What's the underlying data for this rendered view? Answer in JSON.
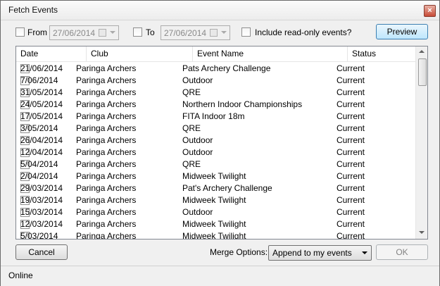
{
  "window": {
    "title": "Fetch Events",
    "close_glyph": "×"
  },
  "filters": {
    "from_label": "From",
    "from_date": "27/06/2014",
    "to_label": "To",
    "to_date": "27/06/2014",
    "readonly_label": "Include read-only events?",
    "preview_label": "Preview"
  },
  "table": {
    "columns": [
      "Date",
      "Club",
      "Event Name",
      "Status"
    ],
    "rows": [
      [
        "21/06/2014",
        "Paringa Archers",
        "Pats Archery Challenge",
        "Current"
      ],
      [
        "7/06/2014",
        "Paringa Archers",
        "Outdoor",
        "Current"
      ],
      [
        "31/05/2014",
        "Paringa Archers",
        "QRE",
        "Current"
      ],
      [
        "24/05/2014",
        "Paringa Archers",
        "Northern Indoor Championships",
        "Current"
      ],
      [
        "17/05/2014",
        "Paringa Archers",
        "FITA Indoor 18m",
        "Current"
      ],
      [
        "3/05/2014",
        "Paringa Archers",
        "QRE",
        "Current"
      ],
      [
        "26/04/2014",
        "Paringa Archers",
        "Outdoor",
        "Current"
      ],
      [
        "12/04/2014",
        "Paringa Archers",
        "Outdoor",
        "Current"
      ],
      [
        "5/04/2014",
        "Paringa Archers",
        "QRE",
        "Current"
      ],
      [
        "2/04/2014",
        "Paringa Archers",
        "Midweek Twilight",
        "Current"
      ],
      [
        "29/03/2014",
        "Paringa Archers",
        "Pat's Archery Challenge",
        "Current"
      ],
      [
        "19/03/2014",
        "Paringa Archers",
        "Midweek Twilight",
        "Current"
      ],
      [
        "15/03/2014",
        "Paringa Archers",
        "Outdoor",
        "Current"
      ],
      [
        "12/03/2014",
        "Paringa Archers",
        "Midweek Twilight",
        "Current"
      ],
      [
        "5/03/2014",
        "Paringa Archers",
        "Midweek Twilight",
        "Current"
      ]
    ]
  },
  "footer": {
    "cancel_label": "Cancel",
    "merge_label": "Merge Options:",
    "merge_value": "Append to my events",
    "ok_label": "OK"
  },
  "statusbar": {
    "text": "Online"
  }
}
